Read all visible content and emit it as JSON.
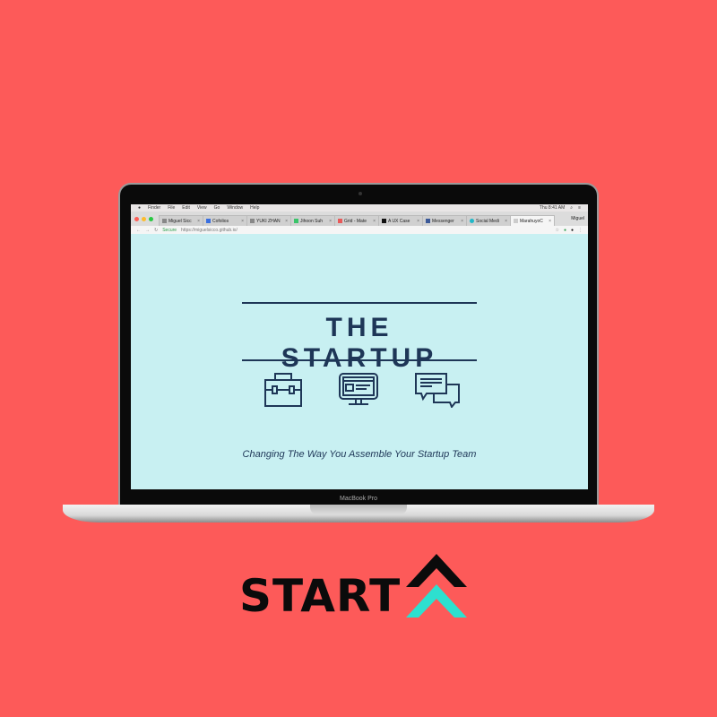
{
  "menubar": {
    "items": [
      "Finder",
      "File",
      "Edit",
      "View",
      "Go",
      "Window",
      "Help"
    ],
    "clock": "Thu 8:41 AM"
  },
  "tabs": [
    {
      "label": "Miguel Sicc"
    },
    {
      "label": "Cofolios"
    },
    {
      "label": "YUKI ZHAN"
    },
    {
      "label": "Jihoon Suh"
    },
    {
      "label": "Grid - Mate"
    },
    {
      "label": "A UX Case"
    },
    {
      "label": "Messenger"
    },
    {
      "label": "Social Medi"
    },
    {
      "label": "MarahuyoC",
      "active": true
    }
  ],
  "profile": "Miguel",
  "address": {
    "secure": "Secure",
    "url": "https://miguelsicco.github.io/"
  },
  "page": {
    "title": "THE STARTUP",
    "tagline": "Changing The Way You Assemble Your Startup Team"
  },
  "laptop_label": "MacBook Pro",
  "logo": {
    "text": "START",
    "colors": {
      "dark": "#0b0b0b",
      "accent": "#2de0cf"
    }
  },
  "colors": {
    "background": "#fd5a59",
    "screen": "#c8f0f2",
    "navy": "#1e3657"
  }
}
